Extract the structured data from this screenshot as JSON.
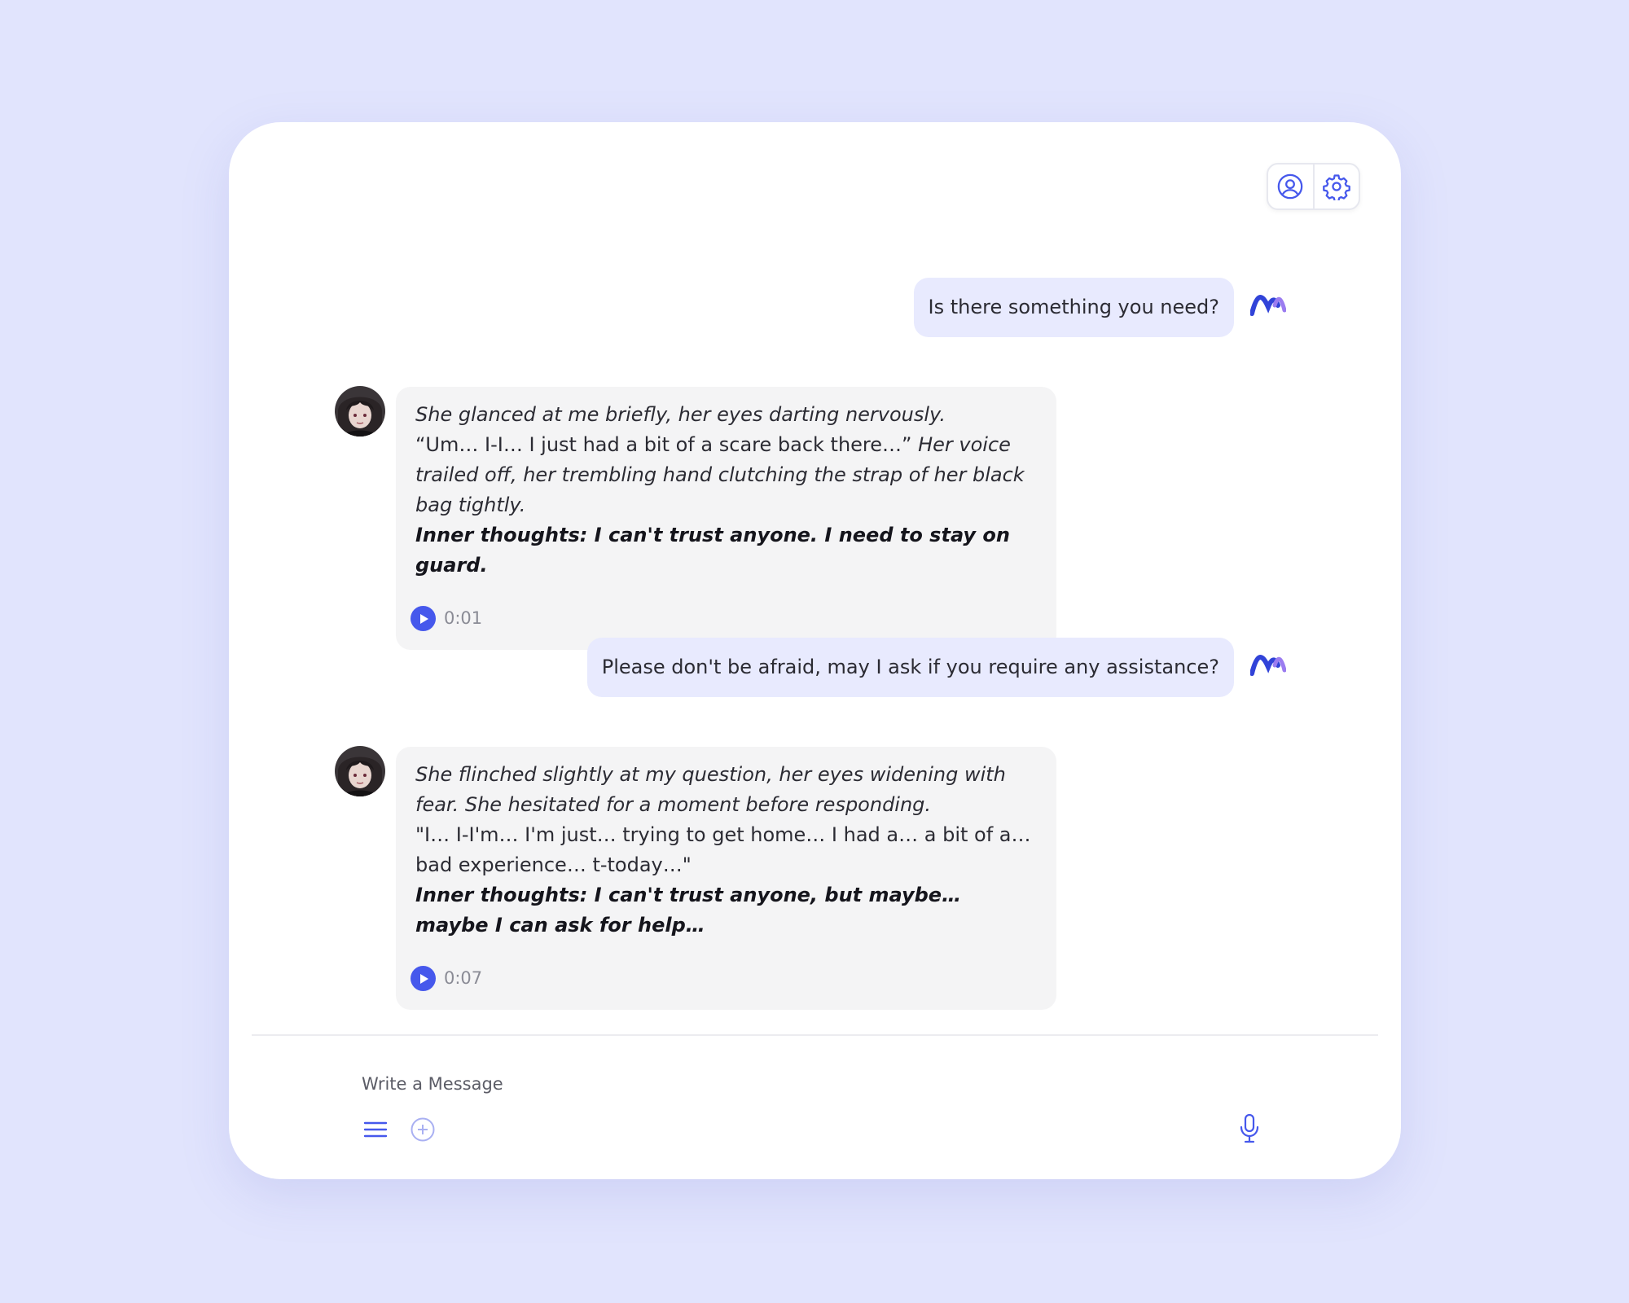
{
  "header": {
    "profile_icon": "user-circle-icon",
    "settings_icon": "gear-icon"
  },
  "colors": {
    "background": "#e1e4fd",
    "accent": "#4658ec",
    "user_bubble": "#e8eafe",
    "bot_bubble": "#f4f4f5"
  },
  "messages": [
    {
      "role": "user",
      "text": "Is there something you need?"
    },
    {
      "role": "character",
      "lines": [
        {
          "style": "italic",
          "text": "She glanced at me briefly, her eyes darting nervously."
        },
        {
          "style": "mixed",
          "speech": "“Um… I-I… I just had a bit of a scare back there…”",
          "action": " Her voice trailed off, her trembling hand clutching the strap of her black bag tightly."
        },
        {
          "style": "thought",
          "text": "Inner thoughts: I can't trust anyone. I need to stay on guard."
        }
      ],
      "audio_duration": "0:01"
    },
    {
      "role": "user",
      "text": "Please don't be afraid, may I ask if you require any assistance?"
    },
    {
      "role": "character",
      "lines": [
        {
          "style": "italic",
          "text": "She flinched slightly at my question, her eyes widening with fear. She hesitated for a moment before responding."
        },
        {
          "style": "plain",
          "text": "\"I… I-I'm… I'm just… trying to get home… I had a… a bit of a… bad experience… t-today…\""
        },
        {
          "style": "thought",
          "text": "Inner thoughts: I can't trust anyone, but maybe… maybe I can ask for help…"
        }
      ],
      "audio_duration": "0:07"
    }
  ],
  "composer": {
    "placeholder": "Write a Message",
    "value": "",
    "menu_icon": "menu-icon",
    "add_icon": "plus-circle-icon",
    "mic_icon": "microphone-icon"
  }
}
